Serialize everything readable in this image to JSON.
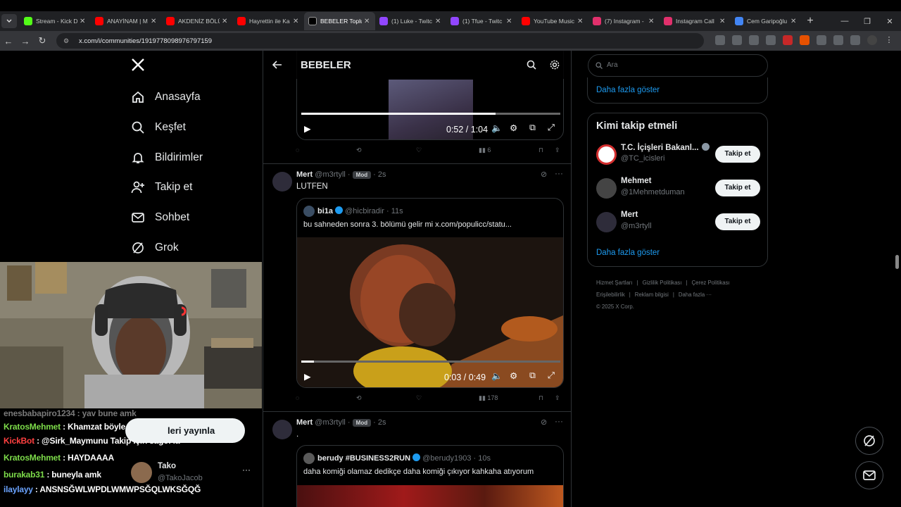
{
  "browser": {
    "tabs": [
      {
        "label": "Stream - Kick D",
        "icon": "kick-icon",
        "color": "#53fc18"
      },
      {
        "label": "ANAYİNAM | M",
        "icon": "youtube-icon",
        "color": "#ff0000"
      },
      {
        "label": "AKDENİZ BÖLÜ",
        "icon": "youtube-icon",
        "color": "#ff0000"
      },
      {
        "label": "Hayrettin ile Ka",
        "icon": "youtube-icon",
        "color": "#ff0000"
      },
      {
        "label": "BEBELER Toplu",
        "icon": "x-icon",
        "color": "#000000",
        "active": true
      },
      {
        "label": "(1) Luke - Twitc",
        "icon": "twitch-icon",
        "color": "#9146ff"
      },
      {
        "label": "(1) Tfue - Twitc",
        "icon": "twitch-icon",
        "color": "#9146ff"
      },
      {
        "label": "YouTube Music",
        "icon": "youtube-music-icon",
        "color": "#ff0000"
      },
      {
        "label": "(7) Instagram -",
        "icon": "instagram-icon",
        "color": "#e1306c"
      },
      {
        "label": "Instagram Call",
        "icon": "instagram-icon",
        "color": "#e1306c"
      },
      {
        "label": "Cem Garipoğlu",
        "icon": "google-icon",
        "color": "#4285f4"
      }
    ],
    "url": "x.com/i/communities/1919778098976797159"
  },
  "nav": {
    "items": [
      {
        "label": "Anasayfa",
        "icon": "home-icon"
      },
      {
        "label": "Keşfet",
        "icon": "search-icon"
      },
      {
        "label": "Bildirimler",
        "icon": "bell-icon"
      },
      {
        "label": "Takip et",
        "icon": "add-user-icon"
      },
      {
        "label": "Sohbet",
        "icon": "mail-icon"
      },
      {
        "label": "Grok",
        "icon": "grok-icon"
      }
    ]
  },
  "chat": {
    "lines": [
      {
        "user": "enesbabapiro1234",
        "text": ": yav bune amk",
        "color": "#7a7a7a"
      },
      {
        "user": "KratosMehmet",
        "text": ": Khamzat böyle dövmüyor ...",
        "color": "#7ddc4a"
      },
      {
        "user": "KickBot",
        "text": ": @Sirk_Maymunu Takip için sağol la",
        "color": "#ff4040"
      },
      {
        "user": "KratosMehmet",
        "text": ": HAYDAAAA",
        "color": "#7ddc4a"
      },
      {
        "user": "burakab31",
        "text": ": buneyla amk",
        "color": "#7ddc4a"
      },
      {
        "user": "ilaylayy",
        "text": ": ANSNSĞWLWPDLWMWPSĞQLWKSĞQĞ",
        "color": "#6aa3ff"
      }
    ],
    "popup_label": "leri yayınla",
    "account": {
      "name": "Tako",
      "handle": "@TakoJacob"
    }
  },
  "main": {
    "title": "BEBELER",
    "tweet1": {
      "video_time": "0:52 / 1:04",
      "progress": 0.75,
      "views": "6"
    },
    "tweet2": {
      "name": "Mert",
      "handle": "@m3rtyll",
      "badge": "Mod",
      "time": "2s",
      "text": "LUTFEN",
      "quote": {
        "name": "bi1a",
        "handle": "@hicbiradir",
        "time": "11s",
        "text": "bu sahneden sonra 3. bölümü gelir mi  x.com/populicc/statu..."
      },
      "video_time": "0:03 / 0:49",
      "progress": 0.05,
      "views": "178"
    },
    "tweet3": {
      "name": "Mert",
      "handle": "@m3rtyll",
      "badge": "Mod",
      "time": "2s",
      "text": ".",
      "quote": {
        "name": "berudy #BUSINESS2RUN",
        "handle": "@berudy1903",
        "time": "10s",
        "text": "daha komiği olamaz dedikçe daha komiği çıkıyor kahkaha atıyorum"
      }
    }
  },
  "right": {
    "search_placeholder": "Ara",
    "show_more_top": "Daha fazla göster",
    "who_to_follow_title": "Kimi takip etmeli",
    "follows": [
      {
        "name": "T.C. İçişleri Bakanl...",
        "handle": "@TC_icisleri",
        "button": "Takip et",
        "verified": true
      },
      {
        "name": "Mehmet",
        "handle": "@1Mehmetduman",
        "button": "Takip et",
        "verified": false
      },
      {
        "name": "Mert",
        "handle": "@m3rtyll",
        "button": "Takip et",
        "verified": false
      }
    ],
    "show_more": "Daha fazla göster",
    "footer": [
      "Hizmet Şartları",
      "Gizlilik Politikası",
      "Çerez Politikası",
      "Erişilebilirlik",
      "Reklam bilgisi",
      "Daha fazla ···",
      "© 2025 X Corp."
    ]
  },
  "colors": {
    "accent": "#1d9bf0",
    "background": "#000000",
    "border": "#2f3336"
  }
}
